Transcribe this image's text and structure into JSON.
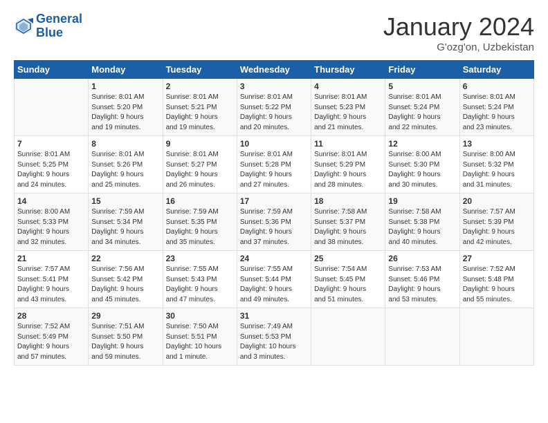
{
  "header": {
    "logo_line1": "General",
    "logo_line2": "Blue",
    "month": "January 2024",
    "location": "G'ozg'on, Uzbekistan"
  },
  "weekdays": [
    "Sunday",
    "Monday",
    "Tuesday",
    "Wednesday",
    "Thursday",
    "Friday",
    "Saturday"
  ],
  "weeks": [
    [
      {
        "day": "",
        "info": ""
      },
      {
        "day": "1",
        "info": "Sunrise: 8:01 AM\nSunset: 5:20 PM\nDaylight: 9 hours\nand 19 minutes."
      },
      {
        "day": "2",
        "info": "Sunrise: 8:01 AM\nSunset: 5:21 PM\nDaylight: 9 hours\nand 19 minutes."
      },
      {
        "day": "3",
        "info": "Sunrise: 8:01 AM\nSunset: 5:22 PM\nDaylight: 9 hours\nand 20 minutes."
      },
      {
        "day": "4",
        "info": "Sunrise: 8:01 AM\nSunset: 5:23 PM\nDaylight: 9 hours\nand 21 minutes."
      },
      {
        "day": "5",
        "info": "Sunrise: 8:01 AM\nSunset: 5:24 PM\nDaylight: 9 hours\nand 22 minutes."
      },
      {
        "day": "6",
        "info": "Sunrise: 8:01 AM\nSunset: 5:24 PM\nDaylight: 9 hours\nand 23 minutes."
      }
    ],
    [
      {
        "day": "7",
        "info": "Sunrise: 8:01 AM\nSunset: 5:25 PM\nDaylight: 9 hours\nand 24 minutes."
      },
      {
        "day": "8",
        "info": "Sunrise: 8:01 AM\nSunset: 5:26 PM\nDaylight: 9 hours\nand 25 minutes."
      },
      {
        "day": "9",
        "info": "Sunrise: 8:01 AM\nSunset: 5:27 PM\nDaylight: 9 hours\nand 26 minutes."
      },
      {
        "day": "10",
        "info": "Sunrise: 8:01 AM\nSunset: 5:28 PM\nDaylight: 9 hours\nand 27 minutes."
      },
      {
        "day": "11",
        "info": "Sunrise: 8:01 AM\nSunset: 5:29 PM\nDaylight: 9 hours\nand 28 minutes."
      },
      {
        "day": "12",
        "info": "Sunrise: 8:00 AM\nSunset: 5:30 PM\nDaylight: 9 hours\nand 30 minutes."
      },
      {
        "day": "13",
        "info": "Sunrise: 8:00 AM\nSunset: 5:32 PM\nDaylight: 9 hours\nand 31 minutes."
      }
    ],
    [
      {
        "day": "14",
        "info": "Sunrise: 8:00 AM\nSunset: 5:33 PM\nDaylight: 9 hours\nand 32 minutes."
      },
      {
        "day": "15",
        "info": "Sunrise: 7:59 AM\nSunset: 5:34 PM\nDaylight: 9 hours\nand 34 minutes."
      },
      {
        "day": "16",
        "info": "Sunrise: 7:59 AM\nSunset: 5:35 PM\nDaylight: 9 hours\nand 35 minutes."
      },
      {
        "day": "17",
        "info": "Sunrise: 7:59 AM\nSunset: 5:36 PM\nDaylight: 9 hours\nand 37 minutes."
      },
      {
        "day": "18",
        "info": "Sunrise: 7:58 AM\nSunset: 5:37 PM\nDaylight: 9 hours\nand 38 minutes."
      },
      {
        "day": "19",
        "info": "Sunrise: 7:58 AM\nSunset: 5:38 PM\nDaylight: 9 hours\nand 40 minutes."
      },
      {
        "day": "20",
        "info": "Sunrise: 7:57 AM\nSunset: 5:39 PM\nDaylight: 9 hours\nand 42 minutes."
      }
    ],
    [
      {
        "day": "21",
        "info": "Sunrise: 7:57 AM\nSunset: 5:41 PM\nDaylight: 9 hours\nand 43 minutes."
      },
      {
        "day": "22",
        "info": "Sunrise: 7:56 AM\nSunset: 5:42 PM\nDaylight: 9 hours\nand 45 minutes."
      },
      {
        "day": "23",
        "info": "Sunrise: 7:55 AM\nSunset: 5:43 PM\nDaylight: 9 hours\nand 47 minutes."
      },
      {
        "day": "24",
        "info": "Sunrise: 7:55 AM\nSunset: 5:44 PM\nDaylight: 9 hours\nand 49 minutes."
      },
      {
        "day": "25",
        "info": "Sunrise: 7:54 AM\nSunset: 5:45 PM\nDaylight: 9 hours\nand 51 minutes."
      },
      {
        "day": "26",
        "info": "Sunrise: 7:53 AM\nSunset: 5:46 PM\nDaylight: 9 hours\nand 53 minutes."
      },
      {
        "day": "27",
        "info": "Sunrise: 7:52 AM\nSunset: 5:48 PM\nDaylight: 9 hours\nand 55 minutes."
      }
    ],
    [
      {
        "day": "28",
        "info": "Sunrise: 7:52 AM\nSunset: 5:49 PM\nDaylight: 9 hours\nand 57 minutes."
      },
      {
        "day": "29",
        "info": "Sunrise: 7:51 AM\nSunset: 5:50 PM\nDaylight: 9 hours\nand 59 minutes."
      },
      {
        "day": "30",
        "info": "Sunrise: 7:50 AM\nSunset: 5:51 PM\nDaylight: 10 hours\nand 1 minute."
      },
      {
        "day": "31",
        "info": "Sunrise: 7:49 AM\nSunset: 5:53 PM\nDaylight: 10 hours\nand 3 minutes."
      },
      {
        "day": "",
        "info": ""
      },
      {
        "day": "",
        "info": ""
      },
      {
        "day": "",
        "info": ""
      }
    ]
  ]
}
